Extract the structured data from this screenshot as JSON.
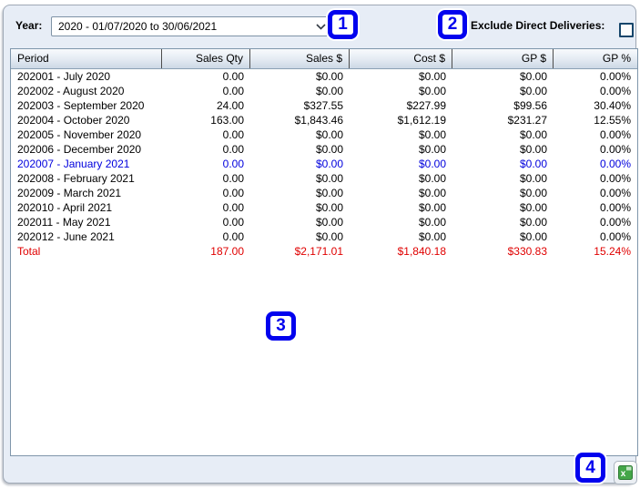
{
  "toolbar": {
    "year_label": "Year:",
    "year_value": "2020 - 01/07/2020 to 30/06/2021",
    "exclude_label": "Exclude Direct Deliveries:",
    "exclude_checked": false
  },
  "table": {
    "columns": [
      "Period",
      "Sales Qty",
      "Sales $",
      "Cost $",
      "GP $",
      "GP %"
    ],
    "rows": [
      {
        "style": "normal",
        "cells": [
          "202001 - July 2020",
          "0.00",
          "$0.00",
          "$0.00",
          "$0.00",
          "0.00%"
        ]
      },
      {
        "style": "normal",
        "cells": [
          "202002 - August 2020",
          "0.00",
          "$0.00",
          "$0.00",
          "$0.00",
          "0.00%"
        ]
      },
      {
        "style": "normal",
        "cells": [
          "202003 - September 2020",
          "24.00",
          "$327.55",
          "$227.99",
          "$99.56",
          "30.40%"
        ]
      },
      {
        "style": "normal",
        "cells": [
          "202004 - October 2020",
          "163.00",
          "$1,843.46",
          "$1,612.19",
          "$231.27",
          "12.55%"
        ]
      },
      {
        "style": "normal",
        "cells": [
          "202005 - November 2020",
          "0.00",
          "$0.00",
          "$0.00",
          "$0.00",
          "0.00%"
        ]
      },
      {
        "style": "normal",
        "cells": [
          "202006 - December 2020",
          "0.00",
          "$0.00",
          "$0.00",
          "$0.00",
          "0.00%"
        ]
      },
      {
        "style": "current",
        "cells": [
          "202007 - January 2021",
          "0.00",
          "$0.00",
          "$0.00",
          "$0.00",
          "0.00%"
        ]
      },
      {
        "style": "normal",
        "cells": [
          "202008 - February 2021",
          "0.00",
          "$0.00",
          "$0.00",
          "$0.00",
          "0.00%"
        ]
      },
      {
        "style": "normal",
        "cells": [
          "202009 - March 2021",
          "0.00",
          "$0.00",
          "$0.00",
          "$0.00",
          "0.00%"
        ]
      },
      {
        "style": "normal",
        "cells": [
          "202010 - April 2021",
          "0.00",
          "$0.00",
          "$0.00",
          "$0.00",
          "0.00%"
        ]
      },
      {
        "style": "normal",
        "cells": [
          "202011 - May 2021",
          "0.00",
          "$0.00",
          "$0.00",
          "$0.00",
          "0.00%"
        ]
      },
      {
        "style": "normal",
        "cells": [
          "202012 - June 2021",
          "0.00",
          "$0.00",
          "$0.00",
          "$0.00",
          "0.00%"
        ]
      },
      {
        "style": "total",
        "cells": [
          "Total",
          "187.00",
          "$2,171.01",
          "$1,840.18",
          "$330.83",
          "15.24%"
        ]
      }
    ]
  },
  "annotations": {
    "badges": [
      "1",
      "2",
      "3",
      "4"
    ]
  },
  "icons": {
    "dropdown_chevron": "chevron-down-icon",
    "excel_export": "excel-export-icon"
  },
  "colors": {
    "window_background": "#e7edf6",
    "current_row_text": "#0000dd",
    "total_row_text": "#e00000",
    "badge_blue": "#0202ee",
    "excel_green": "#44a648"
  }
}
